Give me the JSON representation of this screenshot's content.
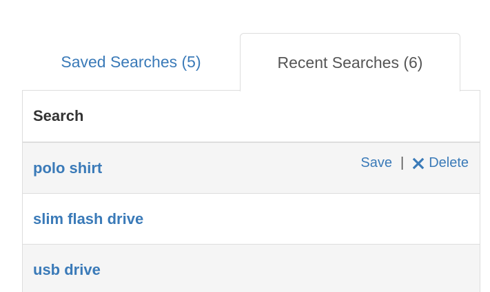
{
  "tabs": [
    {
      "label": "Saved Searches (5)",
      "active": false
    },
    {
      "label": "Recent Searches (6)",
      "active": true
    }
  ],
  "table": {
    "header": "Search",
    "rows": [
      {
        "term": "polo shirt",
        "save_label": "Save",
        "separator": "|",
        "delete_label": "Delete"
      },
      {
        "term": "slim flash drive"
      },
      {
        "term": "usb drive"
      }
    ]
  },
  "colors": {
    "link": "#3a7ab8",
    "border": "#dddddd",
    "stripe": "#f5f5f5"
  },
  "icons": {
    "delete": "close-icon"
  }
}
